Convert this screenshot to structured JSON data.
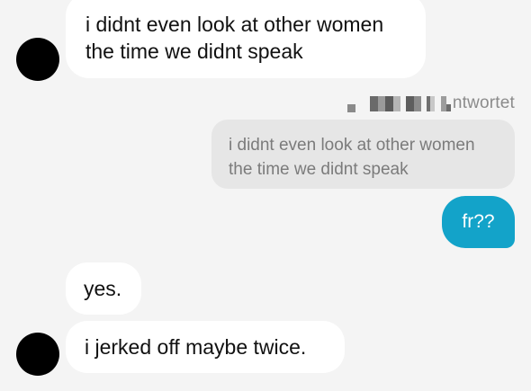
{
  "messages": {
    "incoming_1": {
      "line1": "i didnt even look at other women",
      "line2": "the time we didnt speak"
    },
    "reply_header": {
      "label": "ntwortet"
    },
    "quoted": {
      "line1": "i didnt even look at other women",
      "line2": "the time we didnt speak"
    },
    "outgoing_1": {
      "text": "fr??"
    },
    "incoming_2": {
      "text": "yes."
    },
    "incoming_3": {
      "text": "i jerked off maybe twice."
    }
  },
  "colors": {
    "background": "#f4f4f4",
    "incoming_bubble": "#ffffff",
    "outgoing_bubble": "#13a3c9",
    "quote_bubble": "#e6e6e6",
    "avatar": "#000000"
  }
}
